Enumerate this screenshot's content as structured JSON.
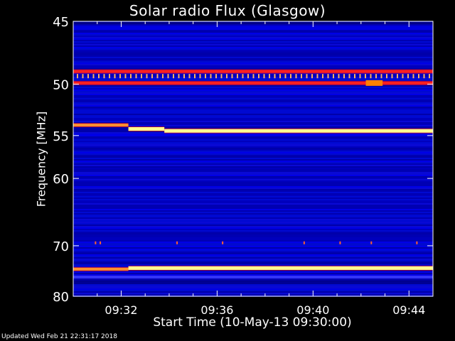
{
  "chart_data": {
    "type": "heatmap",
    "title": "Solar radio Flux (Glasgow)",
    "xlabel": "Start Time (10-May-13 09:30:00)",
    "ylabel": "Frequency [MHz]",
    "x_ticks": [
      "09:32",
      "09:36",
      "09:40",
      "09:44"
    ],
    "x_tick_minutes": [
      2,
      6,
      10,
      14
    ],
    "x_range_minutes": [
      0,
      15
    ],
    "y_ticks": [
      45,
      50,
      55,
      60,
      70,
      80
    ],
    "y_range_mhz": [
      45,
      80
    ],
    "y_scale": "reciprocal",
    "colormap": [
      "#000080",
      "#0000ff",
      "#ff0000",
      "#ff8000",
      "#ffff80"
    ],
    "background_color": "#0000c8",
    "emission_bands": [
      {
        "mhz": 48.9,
        "x_start_min": 0,
        "x_end_min": 15,
        "level": "red"
      },
      {
        "mhz": 49.9,
        "x_start_min": 0,
        "x_end_min": 15,
        "level": "red"
      },
      {
        "mhz": 53.9,
        "x_start_min": 0,
        "x_end_min": 2.3,
        "level": "orange"
      },
      {
        "mhz": 54.3,
        "x_start_min": 2.3,
        "x_end_min": 3.8,
        "level": "yellow"
      },
      {
        "mhz": 54.5,
        "x_start_min": 3.8,
        "x_end_min": 15,
        "level": "yellow"
      },
      {
        "mhz": 74.3,
        "x_start_min": 0,
        "x_end_min": 2.3,
        "level": "orange"
      },
      {
        "mhz": 74.1,
        "x_start_min": 2.3,
        "x_end_min": 15,
        "level": "yellow"
      }
    ]
  },
  "footer": {
    "updated": "Updated Wed Feb 21 22:31:17 2018"
  }
}
